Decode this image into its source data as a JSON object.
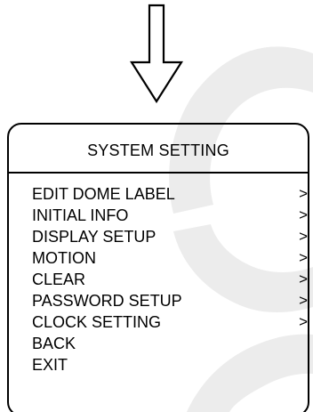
{
  "colors": {
    "foreground": "#000000",
    "background": "#ffffff",
    "watermark": "#ececec"
  },
  "icons": {
    "arrow": "down-arrow-outline-icon",
    "watermark": "logo-watermark"
  },
  "menu": {
    "title": "SYSTEM SETTING",
    "items": [
      {
        "label": "EDIT DOME LABEL",
        "chevron": ">"
      },
      {
        "label": "INITIAL INFO",
        "chevron": ">"
      },
      {
        "label": "DISPLAY SETUP",
        "chevron": ">"
      },
      {
        "label": "MOTION",
        "chevron": ">"
      },
      {
        "label": "CLEAR",
        "chevron": ">"
      },
      {
        "label": "PASSWORD SETUP",
        "chevron": ">"
      },
      {
        "label": "CLOCK SETTING",
        "chevron": ">"
      },
      {
        "label": "BACK",
        "chevron": ""
      },
      {
        "label": "EXIT",
        "chevron": ""
      }
    ]
  }
}
